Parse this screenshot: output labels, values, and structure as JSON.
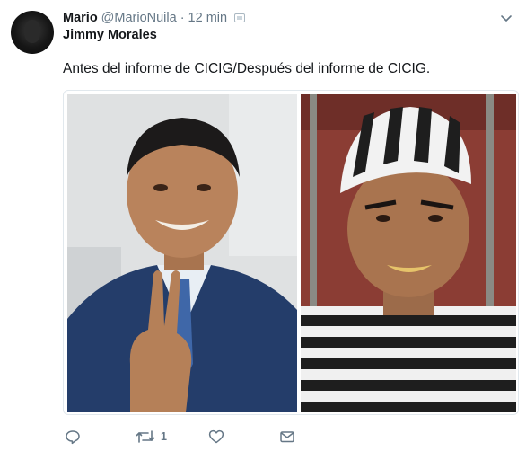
{
  "tweet": {
    "display_name": "Mario",
    "handle": "@MarioNuila",
    "separator": "·",
    "time": "12 min",
    "subtitle": "Jimmy Morales",
    "text": "Antes del informe de CICIG/Después del informe de CICIG."
  },
  "actions": {
    "retweet_count": "1"
  },
  "icons": {
    "reply": "reply-icon",
    "retweet": "retweet-icon",
    "like": "heart-icon",
    "message": "envelope-icon",
    "more": "chevron-down-icon"
  },
  "colors": {
    "muted": "#657786",
    "text": "#14171a",
    "border": "#e1e8ed"
  }
}
